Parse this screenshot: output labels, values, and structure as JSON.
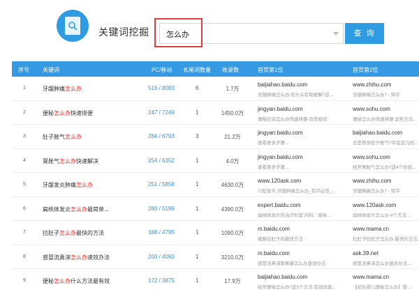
{
  "page_title": "关键词挖掘",
  "search": {
    "value": "怎么办",
    "button": "查 询"
  },
  "table": {
    "headers": [
      "序号",
      "关键词",
      "PC/移动",
      "长尾词数量",
      "收录数",
      "首页第1位",
      "首页第2位"
    ],
    "rows": [
      {
        "idx": "1",
        "kw_pre": "牙龈肿痛",
        "kw_hl": "怎么办",
        "kw_post": "",
        "pcm": "516 / 8083",
        "lt": "6",
        "rec": "1.7万",
        "d1": "baijiahao.baidu.com",
        "t1": "牙龈肿痛怎么办,吃什么有助缓解?这...",
        "d2": "www.zhihu.com",
        "t2": "牙龈肿痛怎么办? - 知乎"
      },
      {
        "idx": "2",
        "kw_pre": "便秘",
        "kw_hl": "怎么办",
        "kw_post": "快速排便",
        "pcm": "247 / 7249",
        "lt": "1",
        "rec": "1450.0万",
        "d1": "jingyan.baidu.com",
        "t1": "便秘应该怎么办快速排便-百度经验",
        "d2": "www.sohu.com",
        "t2": "便秘怎么办快速排便 这些方法..."
      },
      {
        "idx": "3",
        "kw_pre": "肚子胀气",
        "kw_hl": "怎么办",
        "kw_post": "",
        "pcm": "284 / 6793",
        "lt": "3",
        "rec": "21.2万",
        "d1": "jingyan.baidu.com",
        "t1": "查看更多步骤...",
        "d2": "baijiahao.baidu.com",
        "t2": "总是感觉肚子胀气?学会这几招..."
      },
      {
        "idx": "4",
        "kw_pre": "胃胀气",
        "kw_hl": "怎么办",
        "kw_post": "快速解决",
        "pcm": "254 / 6352",
        "lt": "1",
        "rec": "4.0万",
        "d1": "jingyan.baidu.com",
        "t1": "查看更多步骤...",
        "d2": "www.sohu.com",
        "t2": "经常胃胀气怎么办?这4个妙招..."
      },
      {
        "idx": "5",
        "kw_pre": "牙龈发炎肿痛",
        "kw_hl": "怎么办",
        "kw_post": "",
        "pcm": "251 / 5858",
        "lt": "1",
        "rec": "4630.0万",
        "d1": "www.120ask.com",
        "t1": "口腔发炎,牙龈肿痛怎么办_有问必答_...",
        "d2": "www.zhihu.com",
        "t2": "牙龈肿痛怎么办? - 知乎"
      },
      {
        "idx": "6",
        "kw_pre": "扁桃体发炎",
        "kw_hl": "怎么办",
        "kw_post": "最简单...",
        "pcm": "280 / 5199",
        "lt": "1",
        "rec": "4390.0万",
        "d1": "expert.baidu.com",
        "t1": "扁桃体发炎的治疗科室:内科、感染...",
        "d2": "www.120ask.com",
        "t2": "扁桃体发炎怎么办 4个方法..."
      },
      {
        "idx": "7",
        "kw_pre": "拉肚子",
        "kw_hl": "怎么办",
        "kw_post": "最快的方法",
        "pcm": "188 / 4795",
        "lt": "1",
        "rec": "1090.0万",
        "d1": "m.baidu.com",
        "t1": "缓解拉肚子的最快方法",
        "d2": "www.mama.cn",
        "t2": "拉肚子拉肚子怎么办 最快的方法..."
      },
      {
        "idx": "8",
        "kw_pre": "感冒流鼻涕",
        "kw_hl": "怎么办",
        "kw_post": "速效办法",
        "pcm": "200 / 4093",
        "lt": "1",
        "rec": "3210.0万",
        "d1": "m.baidu.com",
        "t1": "感冒流鼻涕跟鼻塞怎么办速效办法",
        "d2": "ask.39.net",
        "t2": "感冒流鼻涕怎么办速效办法..."
      },
      {
        "idx": "9",
        "kw_pre": "便秘",
        "kw_hl": "怎么办",
        "kw_post": "什么方法最有效",
        "pcm": "172 / 3875",
        "lt": "1",
        "rec": "17.9万",
        "d1": "baijiahao.baidu.com",
        "t1": "经常便秘怎么办?这5个方法,有效改善...",
        "d2": "www.mama.cn",
        "t2": "【初生婴儿便秘怎么办】婴..."
      }
    ]
  }
}
